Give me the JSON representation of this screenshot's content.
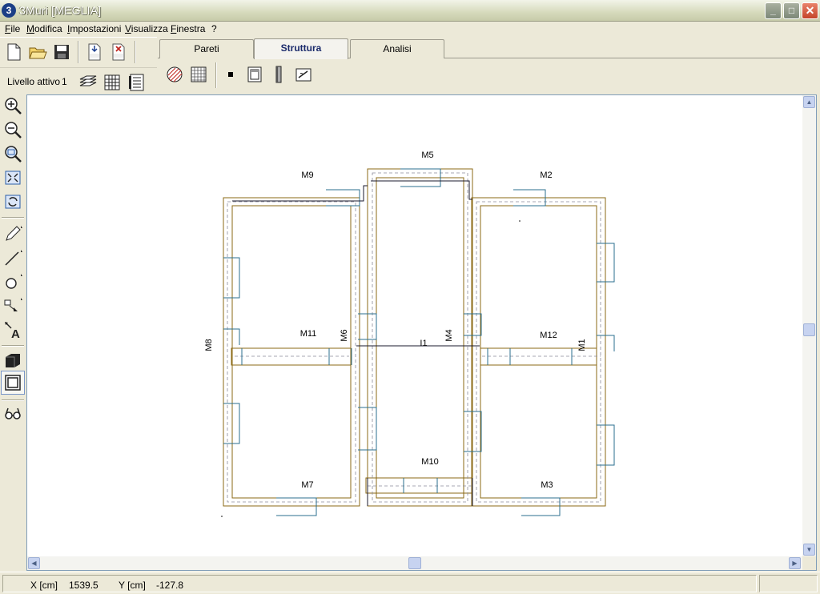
{
  "window": {
    "app_icon": "3",
    "title": "3Muri  [MEGLIA]",
    "minimize": "_",
    "maximize": "□",
    "close": "✕"
  },
  "menu": [
    "File",
    "Modifica",
    "Impostazioni",
    "Visualizza",
    "Finestra",
    "?"
  ],
  "level": {
    "label": "Livello attivo",
    "value": "1"
  },
  "tabs": [
    {
      "label": "Pareti",
      "active": false
    },
    {
      "label": "Struttura",
      "active": true
    },
    {
      "label": "Analisi",
      "active": false
    }
  ],
  "drawing": {
    "wall_labels": [
      "M5",
      "M9",
      "M2",
      "M8",
      "M11",
      "M6",
      "I1",
      "M4",
      "M12",
      "M1",
      "M10",
      "M7",
      "M3"
    ]
  },
  "status": {
    "x_label": "X [cm]",
    "x_value": "1539.5",
    "y_label": "Y [cm]",
    "y_value": "-127.8"
  },
  "colors": {
    "wall_outline": "#8b6914",
    "panel_lines": "#2b6f8f",
    "dashed_axis": "#8a8a9a",
    "tab_active_text": "#1a2a6b"
  },
  "icons": {
    "file_toolbar": [
      "new-file-icon",
      "open-folder-icon",
      "save-icon",
      "import-dxf-icon",
      "delete-dxf-icon"
    ],
    "level_toolbar": [
      "layers-icon",
      "grid-icon",
      "level-list-icon"
    ],
    "struct_toolbar": [
      "hatch-circle-icon",
      "grid-pattern-icon",
      "node-square-icon",
      "panel-frame-icon",
      "pillar-icon",
      "beam-edit-icon"
    ],
    "left_tools": [
      "zoom-in-icon",
      "zoom-out-icon",
      "zoom-window-icon",
      "zoom-extents-icon",
      "refresh-icon",
      "pencil-icon",
      "line-icon",
      "circle-icon",
      "shape-icon",
      "text-icon",
      "layer-solid-icon",
      "frame-icon",
      "glasses-icon"
    ]
  }
}
